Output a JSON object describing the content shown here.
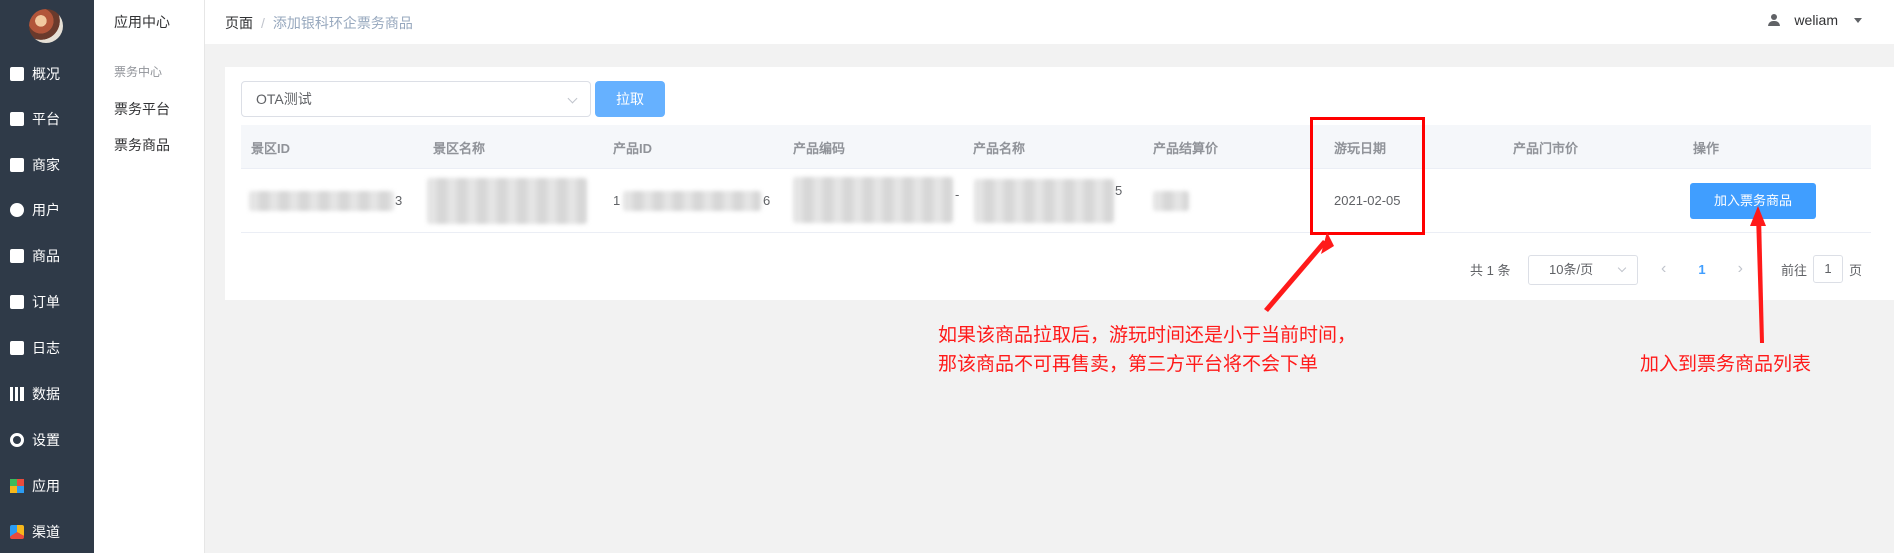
{
  "nav": {
    "items": [
      {
        "label": "概况",
        "icon": "monitor-chart-icon"
      },
      {
        "label": "平台",
        "icon": "desktop-icon"
      },
      {
        "label": "商家",
        "icon": "store-icon"
      },
      {
        "label": "用户",
        "icon": "user-icon"
      },
      {
        "label": "商品",
        "icon": "bag-icon"
      },
      {
        "label": "订单",
        "icon": "clipboard-icon"
      },
      {
        "label": "日志",
        "icon": "book-icon"
      },
      {
        "label": "数据",
        "icon": "bar-chart-icon"
      },
      {
        "label": "设置",
        "icon": "gear-icon"
      },
      {
        "label": "应用",
        "icon": "grid-apps-icon"
      },
      {
        "label": "渠道",
        "icon": "cube-icon"
      }
    ]
  },
  "submenu": {
    "title": "应用中心",
    "group": "票务中心",
    "items": [
      "票务平台",
      "票务商品"
    ]
  },
  "header": {
    "breadcrumb_home": "页面",
    "breadcrumb_sep": "/",
    "breadcrumb_current": "添加银科环企票务商品",
    "username": "weliam"
  },
  "toolbar": {
    "select_value": "OTA测试",
    "fetch_button": "拉取"
  },
  "table": {
    "columns": [
      "景区ID",
      "景区名称",
      "产品ID",
      "产品编码",
      "产品名称",
      "产品结算价",
      "游玩日期",
      "产品门市价",
      "操作"
    ],
    "row": {
      "scenic_id_tail": "3",
      "product_id_head": "1",
      "product_id_tail": "6",
      "product_code_tail": "-",
      "product_name_tail": "5",
      "play_date": "2021-02-05",
      "action_label": "加入票务商品"
    }
  },
  "pagination": {
    "total": "共 1 条",
    "page_size": "10条/页",
    "current_page": "1",
    "goto_label": "前往",
    "goto_value": "1",
    "page_unit": "页"
  },
  "annotations": {
    "note_date_line1": "如果该商品拉取后，游玩时间还是小于当前时间，",
    "note_date_line2": "那该商品不可再售卖，第三方平台将不会下单",
    "note_add": "加入到票务商品列表",
    "color": "#ff1a1a"
  }
}
